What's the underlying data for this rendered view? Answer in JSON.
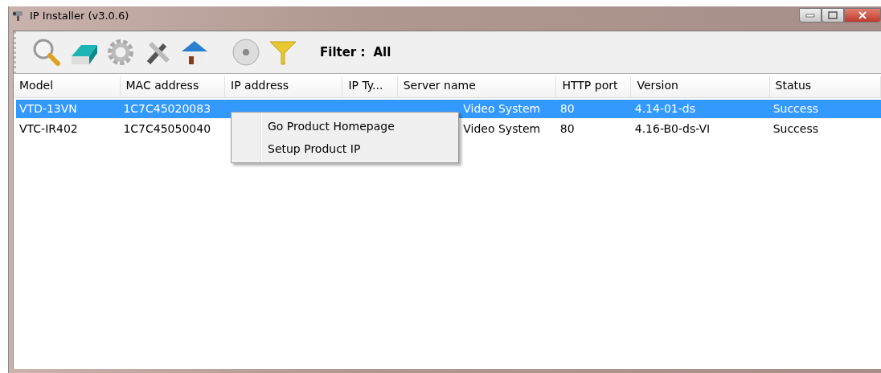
{
  "window": {
    "title": "IP Installer (v3.0.6)"
  },
  "toolbar": {
    "filter_label": "Filter :",
    "filter_value": "All"
  },
  "table": {
    "columns": [
      "Model",
      "MAC address",
      "IP address",
      "IP Ty...",
      "Server name",
      "HTTP port",
      "Version",
      "Status"
    ],
    "rows": [
      {
        "selected": true,
        "cells": [
          "VTD-13VN",
          "1C7C45020083",
          "",
          "",
          "Video System",
          "80",
          "4.14-01-ds",
          "Success"
        ]
      },
      {
        "selected": false,
        "cells": [
          "VTC-IR402",
          "1C7C45050040",
          "",
          "",
          "Video System",
          "80",
          "4.16-B0-ds-VI",
          "Success"
        ]
      }
    ]
  },
  "context_menu": {
    "items": [
      "Go Product Homepage",
      "Setup Product IP"
    ]
  }
}
